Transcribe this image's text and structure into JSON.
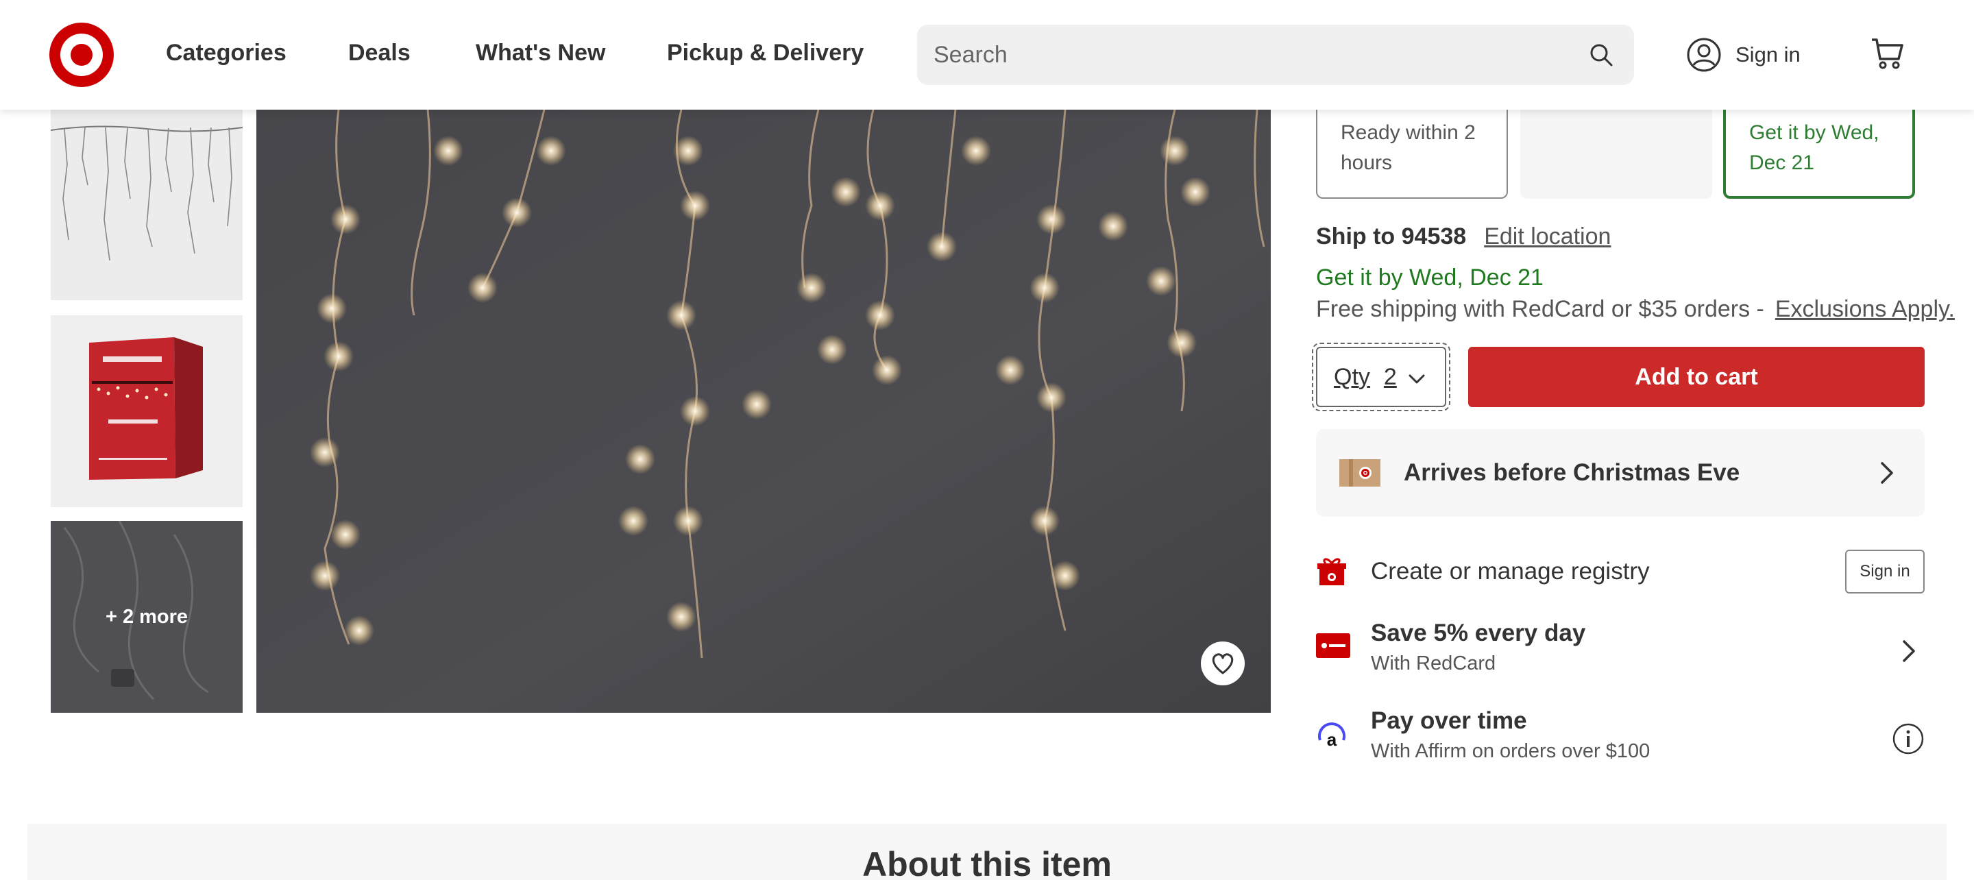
{
  "header": {
    "nav": [
      "Categories",
      "Deals",
      "What's New",
      "Pickup & Delivery"
    ],
    "search_placeholder": "Search",
    "sign_in": "Sign in"
  },
  "gallery": {
    "more_label": "+ 2 more"
  },
  "fulfillment": {
    "pickup_text": "Ready within 2 hours",
    "shipping_text": "Get it by Wed, Dec 21",
    "ship_to_label": "Ship to 94538",
    "edit_location": "Edit location",
    "get_it_by": "Get it by Wed, Dec 21",
    "free_shipping": "Free shipping with RedCard or $35 orders -",
    "exclusions": "Exclusions Apply."
  },
  "purchase": {
    "qty_label": "Qty",
    "qty_value": "2",
    "add_to_cart": "Add to cart"
  },
  "promos": {
    "arrives": "Arrives before Christmas Eve",
    "registry_label": "Create or manage registry",
    "registry_signin": "Sign in",
    "redcard_title": "Save 5% every day",
    "redcard_sub": "With RedCard",
    "affirm_title": "Pay over time",
    "affirm_sub": "With Affirm on orders over $100"
  },
  "about": {
    "title": "About this item"
  },
  "colors": {
    "brand_red": "#cc0000",
    "button_red": "#cc2929",
    "green": "#1f7a1f"
  }
}
